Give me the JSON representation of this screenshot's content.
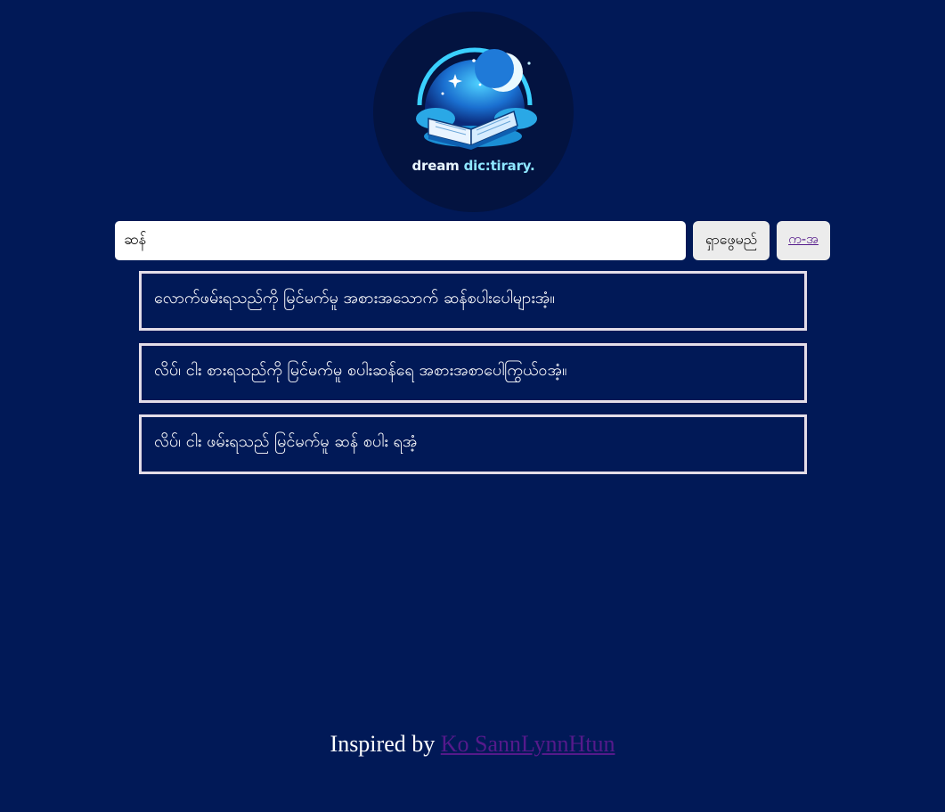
{
  "logo": {
    "text_word1": "dream",
    "text_word2": "dic:tirary."
  },
  "search": {
    "value": "ဆန်",
    "search_button_label": "ရှာဖွေမည်",
    "index_link_label": "က-အ"
  },
  "results": [
    {
      "text": "လောက်ဖမ်းရသည်ကို မြင်မက်မူ အစားအသောက် ဆန်စပါးပေါများအံ့။"
    },
    {
      "text": "လိပ်၊ ငါး စားရသည်ကို မြင်မက်မူ စပါးဆန်ရေ အစားအစာပေါကြွယ်ဝအံ့။"
    },
    {
      "text": "လိပ်၊ ငါး ဖမ်းရသည် မြင်မက်မူ ဆန် စပါး ရအံ့"
    }
  ],
  "footer": {
    "prefix": "Inspired by",
    "link_text": "Ko SannLynnHtun"
  },
  "colors": {
    "background": "#011957",
    "result_border": "#e4dde8",
    "link": "#551a8b"
  }
}
